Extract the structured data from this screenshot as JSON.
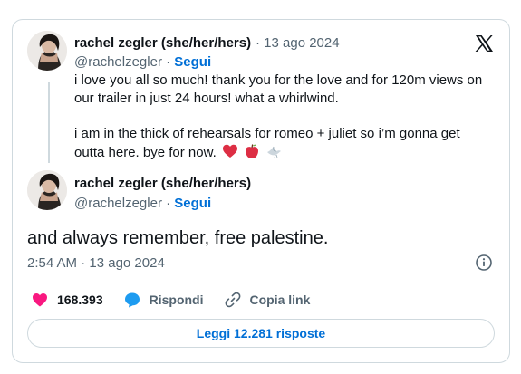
{
  "quoted_tweet": {
    "author_name": "rachel zegler (she/her/hers)",
    "separator": " · ",
    "date": "13 ago 2024",
    "handle": "@rachelzegler",
    "follow_label": "Segui",
    "text_line_1": "i love you all so much! thank you for the love and for 120m views on",
    "text_line_2": "our trailer in just 24 hours! what a whirlwind.",
    "text_line_3": "i am in the thick of rehearsals for romeo + juliet so i’m gonna get",
    "text_line_4": "outta here. bye for now.",
    "emojis": [
      "heart-emoji",
      "apple-emoji",
      "dove-emoji"
    ]
  },
  "main_tweet": {
    "author_name": "rachel zegler (she/her/hers)",
    "handle": "@rachelzegler",
    "follow_label": "Segui",
    "text": "and always remember, free palestine.",
    "time": "2:54 AM",
    "date": "13 ago 2024"
  },
  "actions": {
    "likes_count": "168.393",
    "reply_label": "Rispondi",
    "copy_link_label": "Copia link"
  },
  "read_replies_label": "Leggi 12.281 risposte",
  "colors": {
    "link_blue": "#006fd6",
    "like_pink": "#f91880",
    "reply_blue": "#1d9bf0",
    "muted_gray": "#536471",
    "border": "#cfd9de"
  }
}
